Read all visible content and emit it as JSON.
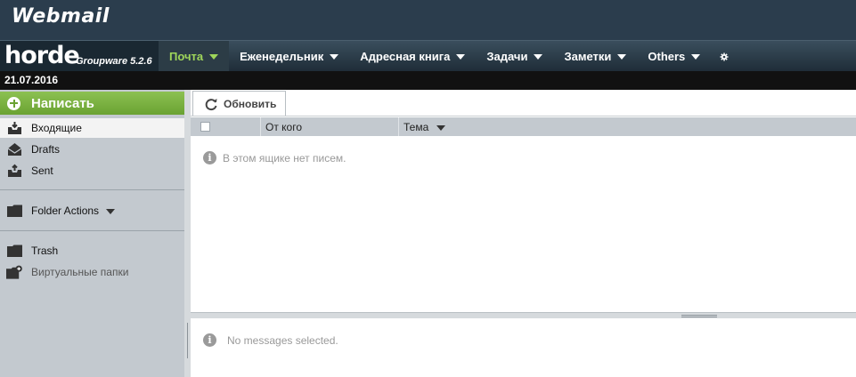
{
  "banner": {
    "title": "Webmail"
  },
  "brand": {
    "name": "horde",
    "version": "Groupware 5.2.6"
  },
  "menu": [
    {
      "label": "Почта",
      "active": true
    },
    {
      "label": "Еженедельник",
      "active": false
    },
    {
      "label": "Адресная книга",
      "active": false
    },
    {
      "label": "Задачи",
      "active": false
    },
    {
      "label": "Заметки",
      "active": false
    },
    {
      "label": "Others",
      "active": false
    }
  ],
  "date": "21.07.2016",
  "sidebar": {
    "compose_label": "Написать",
    "folders": [
      {
        "label": "Входящие",
        "icon": "inbox-icon"
      },
      {
        "label": "Drafts",
        "icon": "drafts-icon"
      },
      {
        "label": "Sent",
        "icon": "sent-icon"
      }
    ],
    "folder_actions": "Folder Actions",
    "trash": "Trash",
    "virtual_folders": "Виртуальные папки"
  },
  "toolbar": {
    "refresh_label": "Обновить"
  },
  "list": {
    "columns": {
      "from": "От кого",
      "subject": "Тема"
    },
    "empty_message": "В этом ящике нет писем."
  },
  "preview": {
    "message": "No messages selected."
  },
  "colors": {
    "accent_green": "#8cc152",
    "banner": "#2b3d4d",
    "active_menu_text": "#9fd65a"
  }
}
